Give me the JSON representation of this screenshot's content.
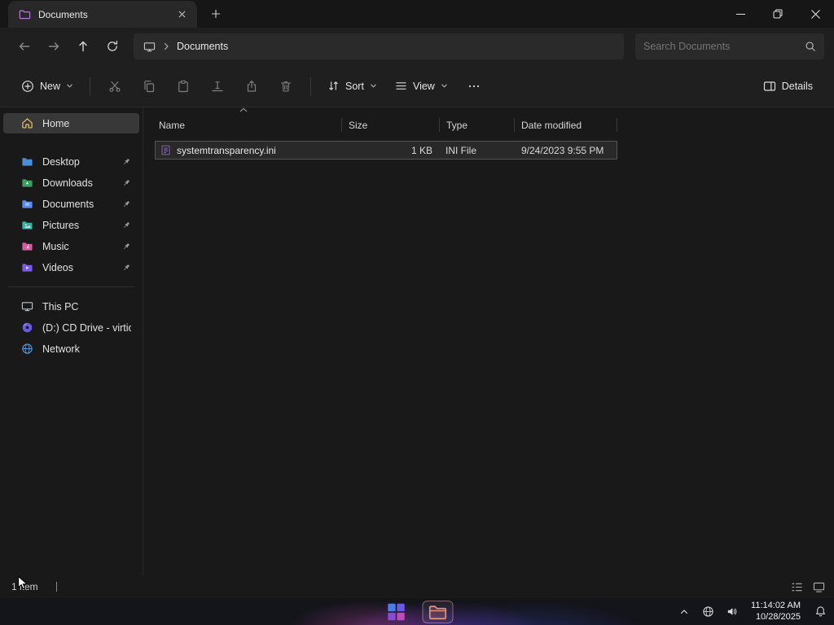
{
  "window": {
    "tab_title": "Documents",
    "breadcrumb": "Documents",
    "search_placeholder": "Search Documents"
  },
  "toolbar": {
    "new": "New",
    "sort": "Sort",
    "view": "View",
    "details": "Details"
  },
  "sidebar": {
    "items": [
      {
        "label": "Home"
      },
      {
        "label": "Desktop"
      },
      {
        "label": "Downloads"
      },
      {
        "label": "Documents"
      },
      {
        "label": "Pictures"
      },
      {
        "label": "Music"
      },
      {
        "label": "Videos"
      },
      {
        "label": "This PC"
      },
      {
        "label": "(D:) CD Drive - virtio-"
      },
      {
        "label": "Network"
      }
    ]
  },
  "file_list": {
    "columns": [
      "Name",
      "Size",
      "Type",
      "Date modified"
    ],
    "sorted_column": "Name",
    "sort_direction": "ascending",
    "rows": [
      {
        "name": "systemtransparency.ini",
        "size": "1 KB",
        "type": "INI File",
        "date_modified": "9/24/2023 9:55 PM"
      }
    ]
  },
  "status_bar": {
    "item_count": "1 item"
  },
  "taskbar": {
    "clock_time": "11:14:02 AM",
    "clock_date": "10/28/2025"
  }
}
